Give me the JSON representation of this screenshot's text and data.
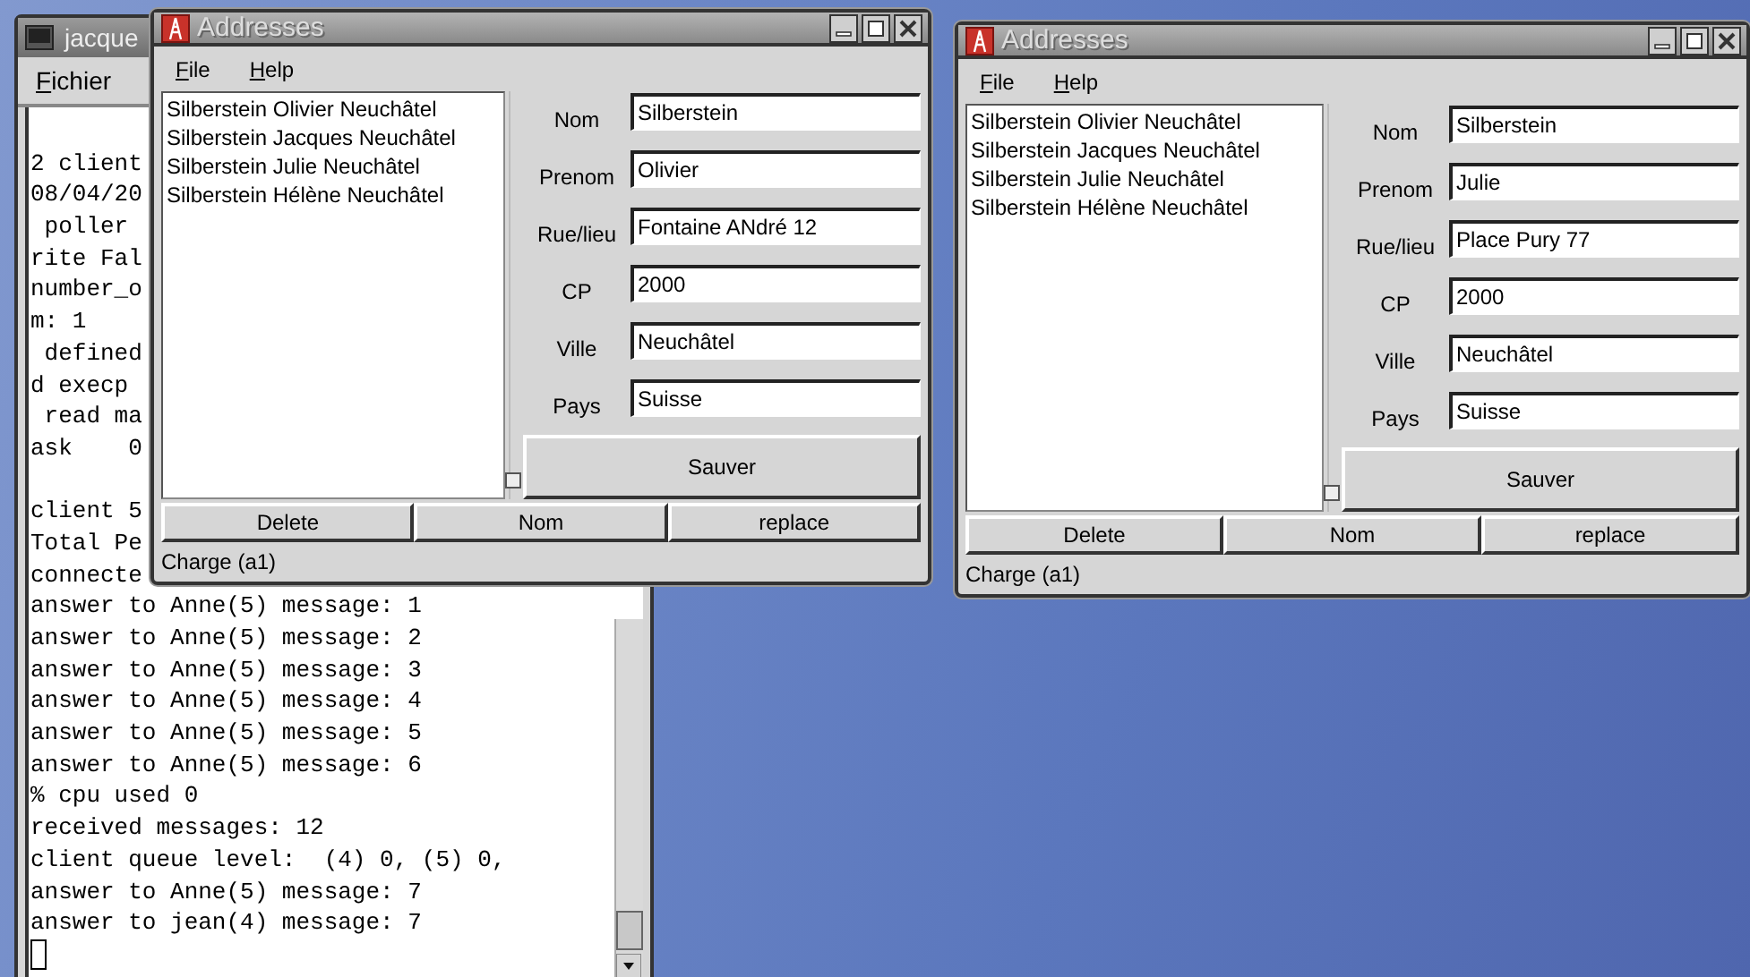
{
  "terminal": {
    "title": "jacque",
    "menu": [
      "Fichier"
    ],
    "lines": [
      {
        "kind": "blank"
      },
      {
        "kind": "text",
        "text": "2 client"
      },
      {
        "kind": "text",
        "text": "08/04/20"
      },
      {
        "kind": "text",
        "text": " poller"
      },
      {
        "kind": "text",
        "text": "rite Fal"
      },
      {
        "kind": "text",
        "text": "number_o"
      },
      {
        "kind": "text",
        "text": "m: 1"
      },
      {
        "kind": "text",
        "text": " defined"
      },
      {
        "kind": "text",
        "text": "d execp"
      },
      {
        "kind": "text",
        "text": " read ma"
      },
      {
        "kind": "text",
        "text": "ask    0"
      },
      {
        "kind": "blank"
      },
      {
        "kind": "text",
        "text": "client 5"
      },
      {
        "kind": "text",
        "text": "Total Pe"
      },
      {
        "kind": "text",
        "text": "connecte"
      },
      {
        "kind": "text",
        "text": "answer to Anne(5) message: 1"
      },
      {
        "kind": "text",
        "text": "answer to Anne(5) message: 2"
      },
      {
        "kind": "text",
        "text": "answer to Anne(5) message: 3"
      },
      {
        "kind": "text",
        "text": "answer to Anne(5) message: 4"
      },
      {
        "kind": "text",
        "text": "answer to Anne(5) message: 5"
      },
      {
        "kind": "text",
        "text": "answer to Anne(5) message: 6"
      },
      {
        "kind": "text",
        "text": "% cpu used 0"
      },
      {
        "kind": "text",
        "text": "received messages: 12"
      },
      {
        "kind": "text",
        "text": "client queue level:  (4) 0, (5) 0,"
      },
      {
        "kind": "text",
        "text": "answer to Anne(5) message: 7"
      },
      {
        "kind": "text",
        "text": "answer to jean(4) message: 7"
      },
      {
        "kind": "cursor"
      }
    ]
  },
  "address_windows": [
    {
      "title": "Addresses",
      "menu": [
        "File",
        "Help"
      ],
      "list": [
        "Silberstein Olivier Neuchâtel",
        "Silberstein Jacques Neuchâtel",
        "Silberstein Julie Neuchâtel",
        "Silberstein Hélène Neuchâtel"
      ],
      "fields": [
        {
          "label": "Nom",
          "value": "Silberstein"
        },
        {
          "label": "Prenom",
          "value": "Olivier"
        },
        {
          "label": "Rue/lieu",
          "value": "Fontaine ANdré 12"
        },
        {
          "label": "CP",
          "value": "2000"
        },
        {
          "label": "Ville",
          "value": "Neuchâtel"
        },
        {
          "label": "Pays",
          "value": "Suisse"
        }
      ],
      "save_button": "Sauver",
      "buttons": [
        "Delete",
        "Nom",
        "replace"
      ],
      "status": "Charge (a1)"
    },
    {
      "title": "Addresses",
      "menu": [
        "File",
        "Help"
      ],
      "list": [
        "Silberstein Olivier Neuchâtel",
        "Silberstein Jacques Neuchâtel",
        "Silberstein Julie Neuchâtel",
        "Silberstein Hélène Neuchâtel"
      ],
      "fields": [
        {
          "label": "Nom",
          "value": "Silberstein"
        },
        {
          "label": "Prenom",
          "value": "Julie"
        },
        {
          "label": "Rue/lieu",
          "value": "Place Pury 77"
        },
        {
          "label": "CP",
          "value": "2000"
        },
        {
          "label": "Ville",
          "value": "Neuchâtel"
        },
        {
          "label": "Pays",
          "value": "Suisse"
        }
      ],
      "save_button": "Sauver",
      "buttons": [
        "Delete",
        "Nom",
        "replace"
      ],
      "status": "Charge (a1)"
    }
  ]
}
